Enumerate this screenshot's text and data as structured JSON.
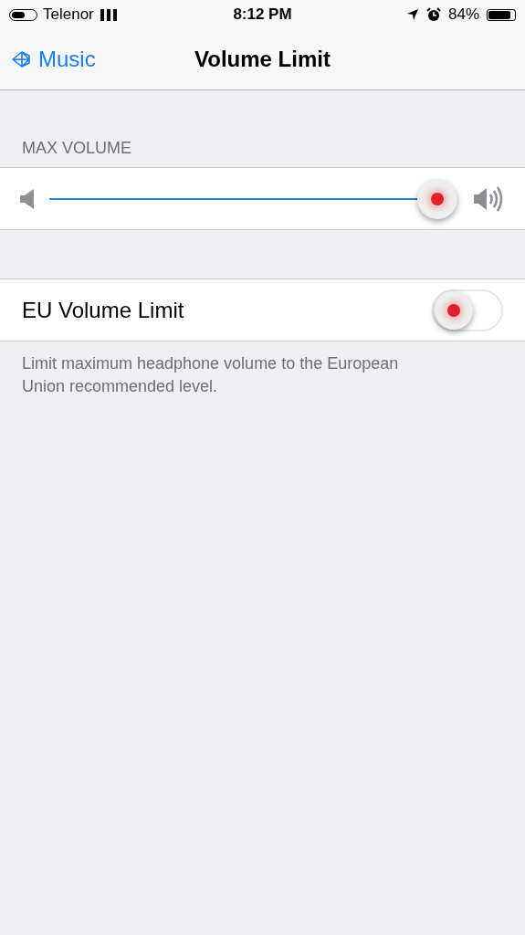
{
  "status_bar": {
    "carrier": "Telenor",
    "time": "8:12 PM",
    "battery_percent": "84%"
  },
  "nav": {
    "back_label": "Music",
    "title": "Volume Limit"
  },
  "max_volume": {
    "header": "MAX VOLUME",
    "level": 1.0
  },
  "eu_limit": {
    "label": "EU Volume Limit",
    "on": false,
    "footer": "Limit maximum headphone volume to the European Union recommended level."
  }
}
